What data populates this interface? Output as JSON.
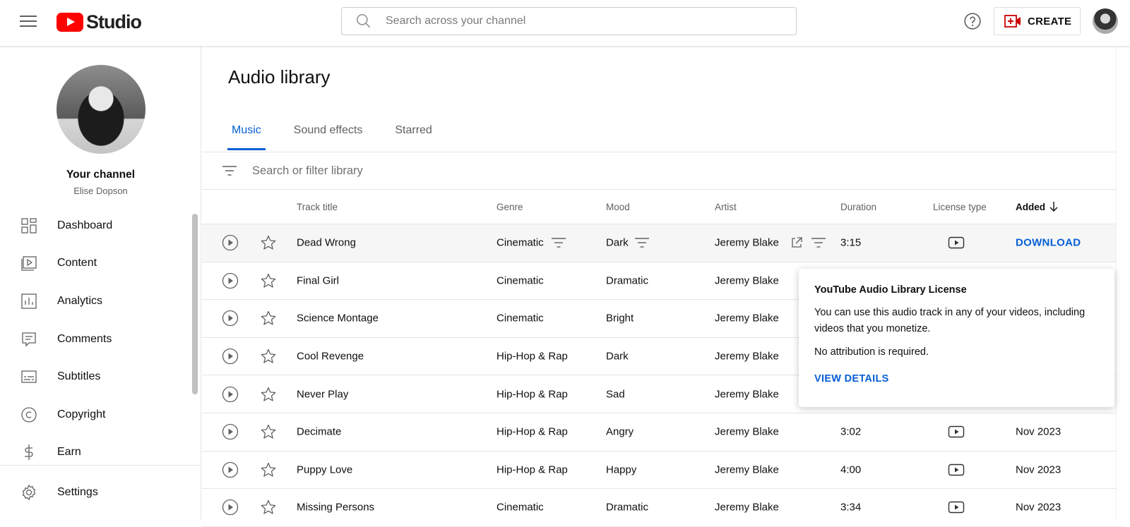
{
  "header": {
    "logo_text": "Studio",
    "search_placeholder": "Search across your channel",
    "create_label": "CREATE"
  },
  "sidebar": {
    "channel_title": "Your channel",
    "channel_name": "Elise Dopson",
    "items": [
      {
        "label": "Dashboard",
        "icon": "dashboard-icon"
      },
      {
        "label": "Content",
        "icon": "content-icon"
      },
      {
        "label": "Analytics",
        "icon": "analytics-icon"
      },
      {
        "label": "Comments",
        "icon": "comments-icon"
      },
      {
        "label": "Subtitles",
        "icon": "subtitles-icon"
      },
      {
        "label": "Copyright",
        "icon": "copyright-icon"
      },
      {
        "label": "Earn",
        "icon": "dollar-icon"
      }
    ],
    "settings_label": "Settings"
  },
  "main": {
    "title": "Audio library",
    "tabs": [
      {
        "label": "Music",
        "active": true
      },
      {
        "label": "Sound effects",
        "active": false
      },
      {
        "label": "Starred",
        "active": false
      }
    ],
    "filter_placeholder": "Search or filter library",
    "columns": {
      "track_title": "Track title",
      "genre": "Genre",
      "mood": "Mood",
      "artist": "Artist",
      "duration": "Duration",
      "license_type": "License type",
      "added": "Added"
    },
    "rows": [
      {
        "title": "Dead Wrong",
        "genre": "Cinematic",
        "mood": "Dark",
        "artist": "Jeremy Blake",
        "duration": "3:15",
        "added": "",
        "action": "DOWNLOAD"
      },
      {
        "title": "Final Girl",
        "genre": "Cinematic",
        "mood": "Dramatic",
        "artist": "Jeremy Blake",
        "duration": "",
        "added": ""
      },
      {
        "title": "Science Montage",
        "genre": "Cinematic",
        "mood": "Bright",
        "artist": "Jeremy Blake",
        "duration": "",
        "added": ""
      },
      {
        "title": "Cool Revenge",
        "genre": "Hip-Hop & Rap",
        "mood": "Dark",
        "artist": "Jeremy Blake",
        "duration": "",
        "added": ""
      },
      {
        "title": "Never Play",
        "genre": "Hip-Hop & Rap",
        "mood": "Sad",
        "artist": "Jeremy Blake",
        "duration": "",
        "added": ""
      },
      {
        "title": "Decimate",
        "genre": "Hip-Hop & Rap",
        "mood": "Angry",
        "artist": "Jeremy Blake",
        "duration": "3:02",
        "added": "Nov 2023"
      },
      {
        "title": "Puppy Love",
        "genre": "Hip-Hop & Rap",
        "mood": "Happy",
        "artist": "Jeremy Blake",
        "duration": "4:00",
        "added": "Nov 2023"
      },
      {
        "title": "Missing Persons",
        "genre": "Cinematic",
        "mood": "Dramatic",
        "artist": "Jeremy Blake",
        "duration": "3:34",
        "added": "Nov 2023"
      }
    ]
  },
  "popover": {
    "title": "YouTube Audio Library License",
    "body": "You can use this audio track in any of your videos, including videos that you monetize.",
    "body2": "No attribution is required.",
    "link": "VIEW DETAILS"
  },
  "colors": {
    "brand_red": "#ff0000",
    "link_blue": "#065fd4",
    "text": "#0f0f0f",
    "secondary_text": "#606060"
  }
}
